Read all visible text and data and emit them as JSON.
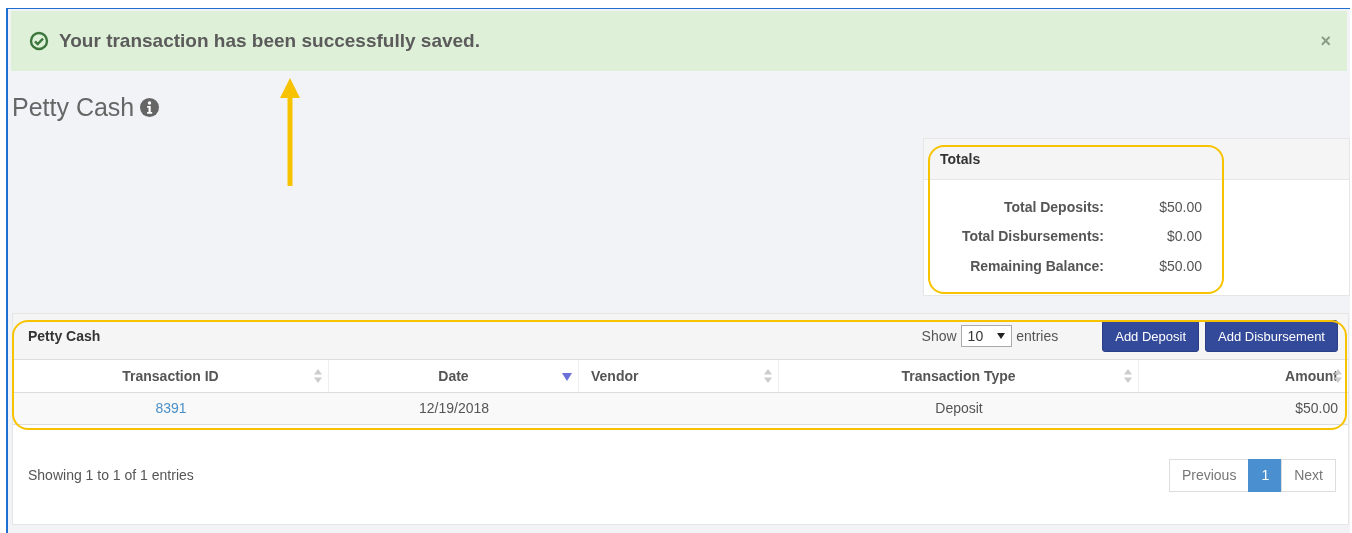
{
  "alert": {
    "message": "Your transaction has been successfully saved.",
    "close": "×"
  },
  "page_title": "Petty Cash",
  "totals": {
    "title": "Totals",
    "rows": [
      {
        "label": "Total Deposits:",
        "value": "$50.00"
      },
      {
        "label": "Total Disbursements:",
        "value": "$0.00"
      },
      {
        "label": "Remaining Balance:",
        "value": "$50.00"
      }
    ]
  },
  "table_panel": {
    "title": "Petty Cash",
    "show_label": "Show",
    "page_size": "10",
    "entries_label": "entries",
    "buttons": [
      "Add Deposit",
      "Add Disbursement"
    ],
    "columns": [
      {
        "label": "Transaction ID",
        "sorted": false
      },
      {
        "label": "Date",
        "sorted": true
      },
      {
        "label": "Vendor",
        "sorted": false
      },
      {
        "label": "Transaction Type",
        "sorted": false
      },
      {
        "label": "Amount",
        "sorted": false
      }
    ],
    "rows": [
      {
        "cells": [
          {
            "text": "8391",
            "kind": "link"
          },
          {
            "text": "12/19/2018",
            "kind": "text"
          },
          {
            "kind": "blank"
          },
          {
            "text": "Deposit",
            "kind": "text"
          },
          {
            "text": "$50.00",
            "kind": "text"
          }
        ]
      }
    ],
    "info": "Showing 1 to 1 of 1 entries",
    "pagination": [
      {
        "label": "Previous",
        "selected": false
      },
      {
        "label": "1",
        "selected": true
      },
      {
        "label": "Next",
        "selected": false
      }
    ]
  }
}
